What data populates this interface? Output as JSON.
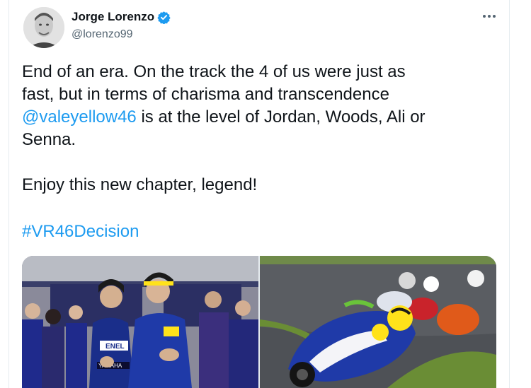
{
  "tweet": {
    "author_name": "Jorge Lorenzo",
    "author_handle": "@lorenzo99",
    "text_line1": "End of an era. On the track the 4 of us were just as",
    "text_line2": "fast, but in terms of charisma and transcendence",
    "mention": "@valeyellow46",
    "text_line3_rest": " is at the level of Jordan, Woods, Ali or",
    "text_line4": "Senna.",
    "text_line5": "Enjoy this new chapter, legend!",
    "hashtag": "#VR46Decision",
    "images": [
      {
        "alt": "Lorenzo and Rossi posing in Yamaha garage"
      },
      {
        "alt": "Rossi leading riders on track"
      }
    ],
    "photo_text": {
      "brand1": "ENEL",
      "brand2": "YAMAHA"
    }
  },
  "icons": {
    "verified": "verified-badge-icon",
    "more": "more-options-icon"
  },
  "colors": {
    "link": "#1d9bf0",
    "secondary_text": "#536471",
    "yamaha_blue": "#1a2e8a"
  }
}
